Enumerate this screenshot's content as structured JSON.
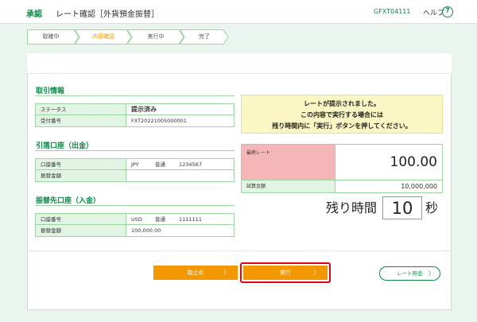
{
  "header": {
    "approve": "承認",
    "title": "レート確認［外貨預金振替］",
    "code": "GFXT04111",
    "help": "ヘルプ",
    "help_icon": "?"
  },
  "steps": [
    {
      "label": "取確中",
      "state": "done"
    },
    {
      "label": "内容確認",
      "state": "current"
    },
    {
      "label": "実行中",
      "state": "todo"
    },
    {
      "label": "完了",
      "state": "todo"
    }
  ],
  "transaction": {
    "title": "取引情報",
    "rows": [
      {
        "label": "ステータス",
        "value": "提示済み"
      },
      {
        "label": "受付番号",
        "value": "FXT20221005000001"
      }
    ]
  },
  "debit": {
    "title": "引落口座（出金）",
    "rows": [
      {
        "label": "口座番号",
        "currency": "JPY",
        "type": "普通",
        "number": "1234567"
      },
      {
        "label": "振替金額",
        "value": ""
      }
    ]
  },
  "credit": {
    "title": "振替先口座（入金）",
    "rows": [
      {
        "label": "口座番号",
        "currency": "USD",
        "type": "普通",
        "number": "1111111"
      },
      {
        "label": "振替金額",
        "value": "100,000.00"
      }
    ]
  },
  "notice": {
    "line1": "レートが提示されました。",
    "line2": "この内容で実行する場合には",
    "line3": "残り時間内に「実行」ボタンを押してください。"
  },
  "rate": {
    "final_label": "最終レート",
    "final_value": "100.00",
    "trial_label": "試算金額",
    "trial_value": "10,000,000"
  },
  "timer": {
    "label": "残り時間",
    "seconds": "10",
    "unit": "秒"
  },
  "buttons": {
    "cancel": "取止め",
    "execute": "実行",
    "rate_inquiry": "レート照会",
    "arrow": "〉"
  },
  "colors": {
    "brand_green": "#0a8a47",
    "action_orange": "#f39800",
    "highlight_red": "#e60012",
    "rate_pink": "#f4b6b6",
    "notice_yellow": "#fbf7c4"
  }
}
